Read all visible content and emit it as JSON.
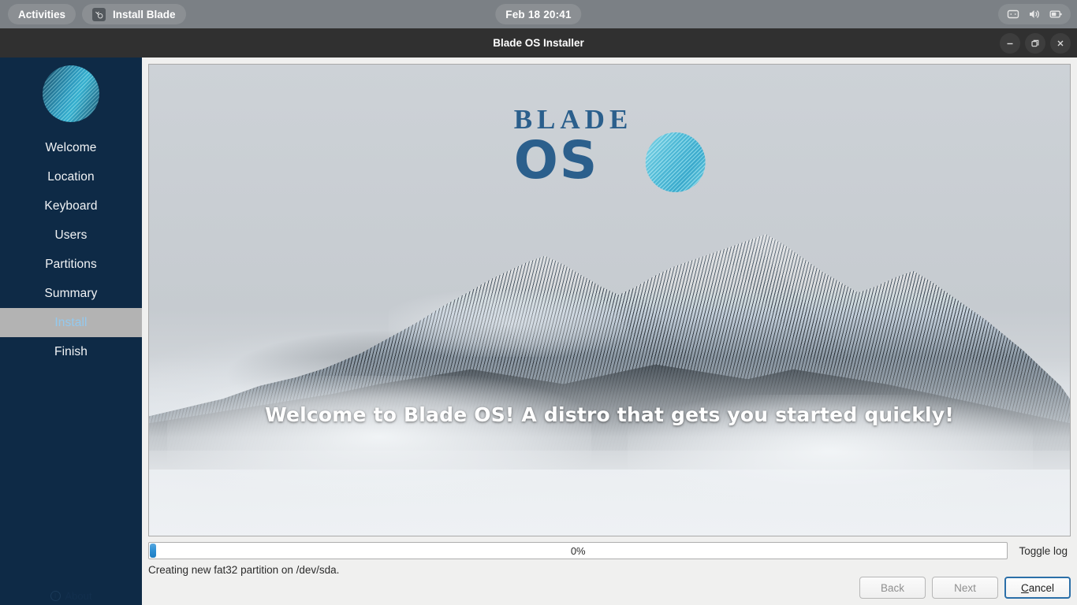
{
  "topbar": {
    "activities": "Activities",
    "app_name": "Install Blade",
    "app_icon": "installer-icon",
    "clock": "Feb 18  20:41",
    "indicators": [
      {
        "name": "network-icon"
      },
      {
        "name": "volume-icon"
      },
      {
        "name": "battery-icon"
      }
    ]
  },
  "window": {
    "title": "Blade OS Installer",
    "controls": [
      {
        "name": "minimize-button",
        "glyph": "minimize"
      },
      {
        "name": "maximize-button",
        "glyph": "restore"
      },
      {
        "name": "close-button",
        "glyph": "close"
      }
    ]
  },
  "sidebar": {
    "logo_name": "blade-os-logo",
    "items": [
      {
        "label": "Welcome",
        "active": false
      },
      {
        "label": "Location",
        "active": false
      },
      {
        "label": "Keyboard",
        "active": false
      },
      {
        "label": "Users",
        "active": false
      },
      {
        "label": "Partitions",
        "active": false
      },
      {
        "label": "Summary",
        "active": false
      },
      {
        "label": "Install",
        "active": true
      },
      {
        "label": "Finish",
        "active": false
      }
    ],
    "about_label": "About",
    "colors": {
      "background": "#0e2a46",
      "active_background": "#b3b3b3",
      "active_text": "#93c9ee",
      "text": "#f2f4f6"
    }
  },
  "slideshow": {
    "brand_line1": "BLADE",
    "brand_line2": "OS",
    "brand_color": "#2b5f8c",
    "caption": "Welcome to Blade OS! A distro that gets you started quickly!"
  },
  "progress": {
    "percent_label": "0%",
    "percent_value": 0,
    "toggle_log_label": "Toggle log",
    "status": "Creating new fat32 partition on /dev/sda.",
    "bar_color": "#2d8fd4"
  },
  "footer": {
    "back_label": "Back",
    "next_label": "Next",
    "cancel_label_prefix": "",
    "cancel_mnemonic": "C",
    "cancel_label_rest": "ancel",
    "back_enabled": false,
    "next_enabled": false,
    "cancel_enabled": true
  }
}
